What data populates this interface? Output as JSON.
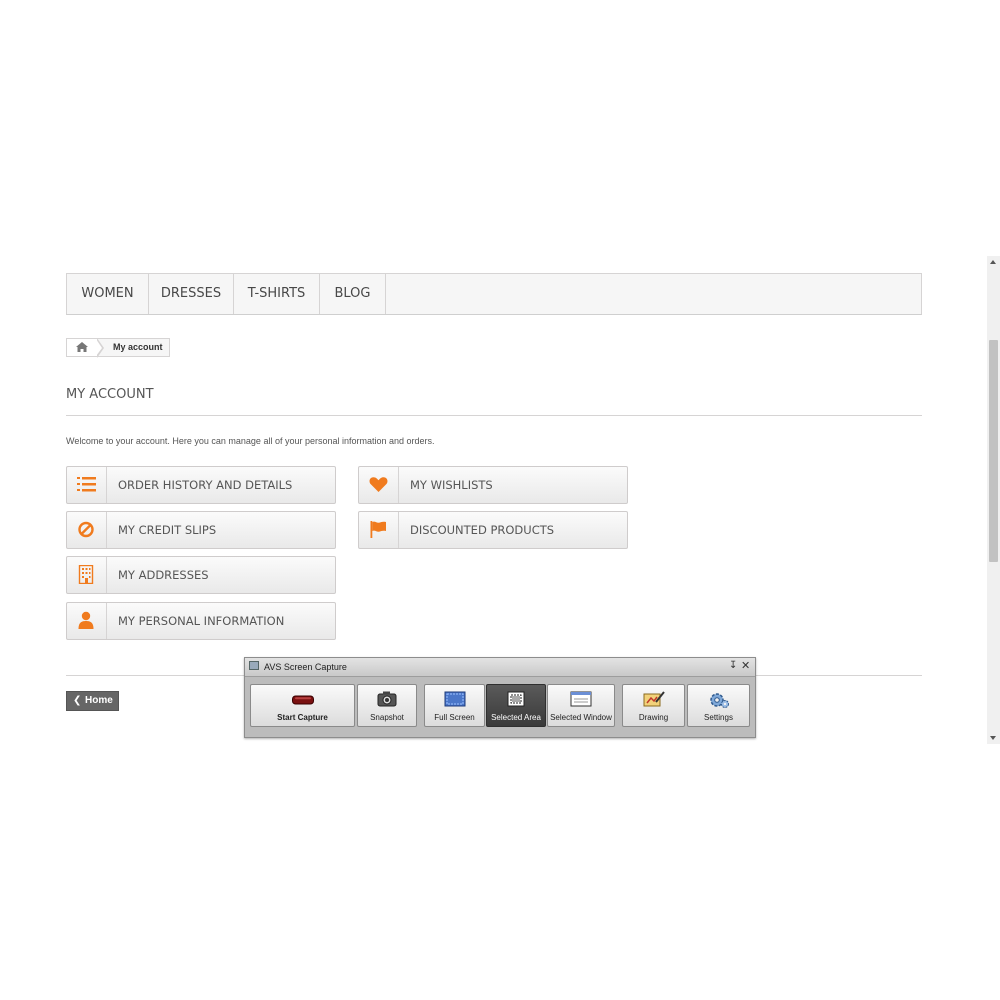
{
  "nav": {
    "items": [
      "WOMEN",
      "DRESSES",
      "T-SHIRTS",
      "BLOG"
    ]
  },
  "breadcrumb": {
    "home_icon": "home-icon",
    "current": "My account"
  },
  "page": {
    "title": "MY ACCOUNT",
    "welcome": "Welcome to your account. Here you can manage all of your personal information and orders.",
    "accent_color": "#f07b1e"
  },
  "account_links": [
    {
      "label": "ORDER HISTORY AND DETAILS",
      "icon": "list-ol-icon"
    },
    {
      "label": "MY CREDIT SLIPS",
      "icon": "ban-icon"
    },
    {
      "label": "MY ADDRESSES",
      "icon": "building-icon"
    },
    {
      "label": "MY PERSONAL INFORMATION",
      "icon": "user-icon"
    },
    {
      "label": "MY WISHLISTS",
      "icon": "heart-icon"
    },
    {
      "label": "DISCOUNTED PRODUCTS",
      "icon": "flag-icon"
    }
  ],
  "footer": {
    "home_label": "Home"
  },
  "capture_toolbar": {
    "title": "AVS Screen Capture",
    "buttons": {
      "start": "Start Capture",
      "snapshot": "Snapshot",
      "full_screen": "Full Screen",
      "selected_area": "Selected Area",
      "selected_window": "Selected Window",
      "drawing": "Drawing",
      "settings": "Settings"
    },
    "active": "Selected Area"
  }
}
